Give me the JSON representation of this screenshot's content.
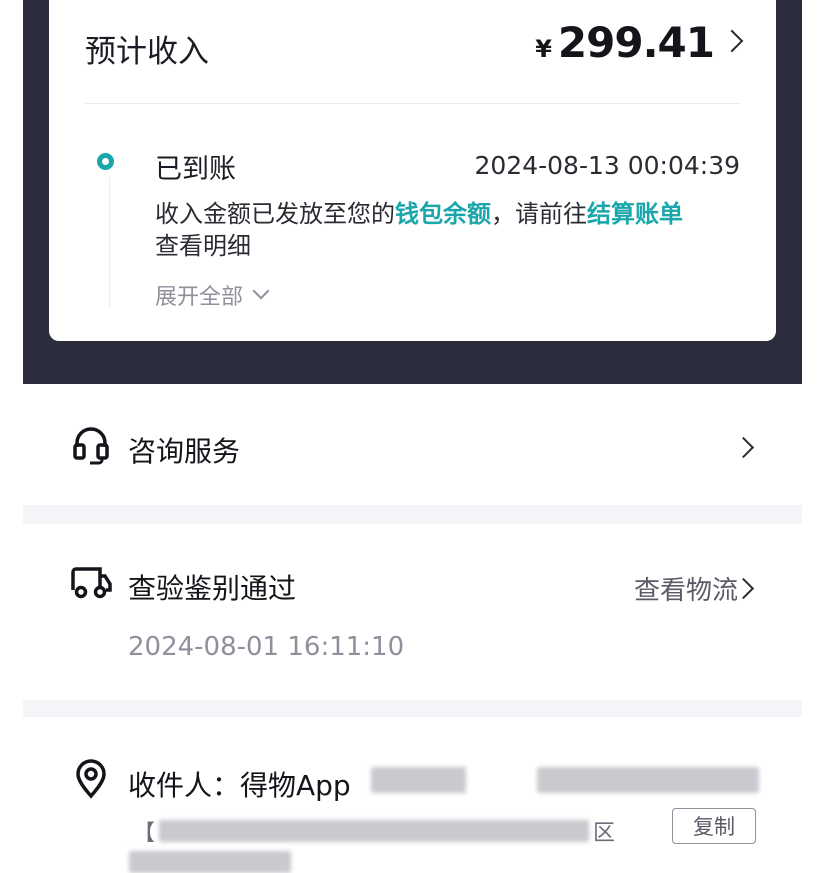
{
  "income": {
    "title": "预计收入",
    "currency": "¥",
    "amount": "299.41",
    "status": {
      "title": "已到账",
      "time": "2024-08-13 00:04:39",
      "desc_part1": "收入金额已发放至您的",
      "link_wallet": "钱包余额",
      "desc_part2": "，请前往",
      "link_bill": "结算账单",
      "desc_part3": "查看明细",
      "expand_label": "展开全部"
    }
  },
  "service": {
    "title": "咨询服务",
    "icon": "headset-icon"
  },
  "logistics": {
    "title": "查验鉴别通过",
    "link": "查看物流",
    "time": "2024-08-01 16:11:10",
    "icon": "truck-icon"
  },
  "address": {
    "label": "收件人：得物App",
    "prefix": "【",
    "suffix": "区",
    "copy_label": "复制",
    "icon": "location-pin-icon"
  },
  "colors": {
    "accent": "#1aa7ab",
    "dark_band": "#2b2c3c",
    "separator": "#f5f5f9"
  }
}
